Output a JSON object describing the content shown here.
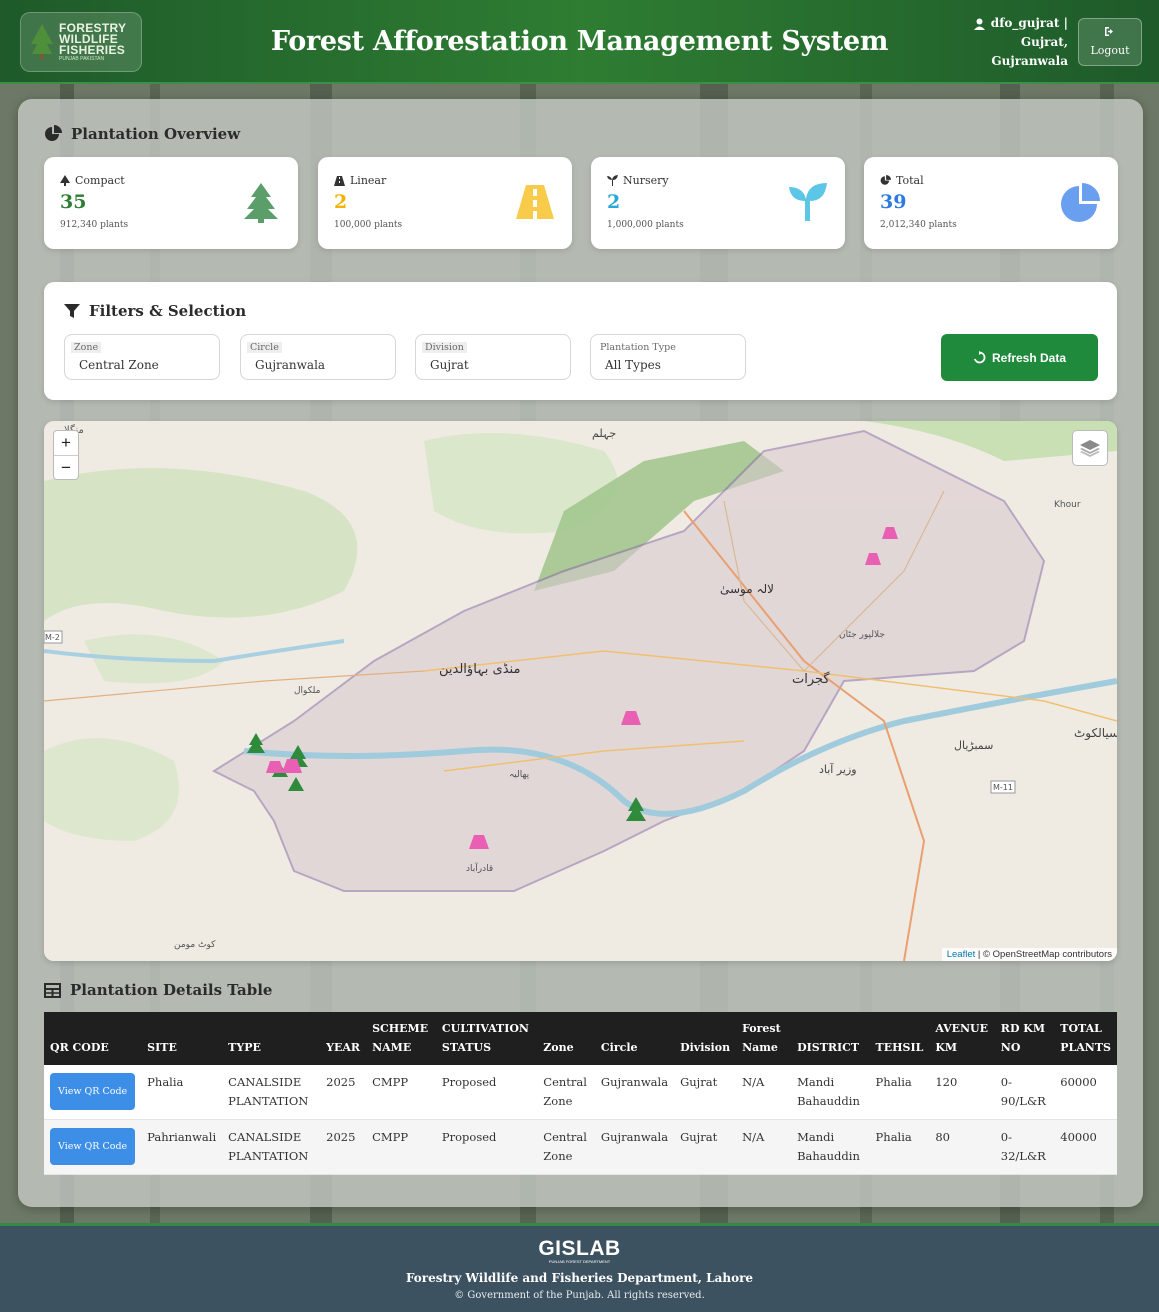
{
  "header": {
    "logo_text": [
      "FORESTRY",
      "WILDLIFE",
      "FISHERIES"
    ],
    "logo_sub": "PUNJAB PAKISTAN",
    "title": "Forest Afforestation Management System",
    "user_line1": "dfo_gujrat |",
    "user_line2": "Gujrat,",
    "user_line3": "Gujranwala",
    "logout_label": "Logout"
  },
  "overview": {
    "title": "Plantation Overview",
    "cards": [
      {
        "label": "Compact",
        "value": "35",
        "sub": "912,340 plants",
        "color": "#2e7d32",
        "icon": "tree-icon"
      },
      {
        "label": "Linear",
        "value": "2",
        "sub": "100,000 plants",
        "color": "#f0b400",
        "icon": "road-icon"
      },
      {
        "label": "Nursery",
        "value": "2",
        "sub": "1,000,000 plants",
        "color": "#29a8d8",
        "icon": "seedling-icon"
      },
      {
        "label": "Total",
        "value": "39",
        "sub": "2,012,340 plants",
        "color": "#2d7be0",
        "icon": "pie-chart-icon"
      }
    ]
  },
  "filters": {
    "title": "Filters & Selection",
    "fields": [
      {
        "label": "Zone",
        "value": "Central Zone"
      },
      {
        "label": "Circle",
        "value": "Gujranwala"
      },
      {
        "label": "Division",
        "value": "Gujrat"
      },
      {
        "label": "Plantation Type",
        "value": "All Types"
      }
    ],
    "refresh_label": "Refresh Data"
  },
  "map": {
    "zoom_in": "+",
    "zoom_out": "−",
    "attribution_leaflet": "Leaflet",
    "attribution_osm": " | © OpenStreetMap contributors",
    "labels": [
      "جہلم",
      "منڈی بہاؤالدین",
      "گجرات",
      "لالہ موسیٰ",
      "سیالکوٹ",
      "وزیر آباد",
      "پھالیہ",
      "قادرآباد",
      "Khour",
      "M-2",
      "M-11",
      "جلالپور جٹاں",
      "سمبڑیال",
      "کوٹ مومن",
      "ملکوال",
      "منگلا"
    ]
  },
  "table": {
    "title": "Plantation Details Table",
    "headers": [
      [
        "QR CODE"
      ],
      [
        "SITE"
      ],
      [
        "TYPE"
      ],
      [
        "YEAR"
      ],
      [
        "SCHEME",
        "NAME"
      ],
      [
        "CULTIVATION",
        "STATUS"
      ],
      [
        "Zone"
      ],
      [
        "Circle"
      ],
      [
        "Division"
      ],
      [
        "Forest",
        "Name"
      ],
      [
        "DISTRICT"
      ],
      [
        "TEHSIL"
      ],
      [
        "AVENUE",
        "KM"
      ],
      [
        "RD KM",
        "NO"
      ],
      [
        "TOTAL",
        "PLANTS"
      ]
    ],
    "rows": [
      {
        "qr": "View QR Code",
        "site": "Phalia",
        "type": "CANALSIDE PLANTATION",
        "year": "2025",
        "scheme": "CMPP",
        "status": "Proposed",
        "zone": "Central Zone",
        "circle": "Gujranwala",
        "division": "Gujrat",
        "forest": "N/A",
        "district": "Mandi Bahauddin",
        "tehsil": "Phalia",
        "avenue": "120",
        "rdkm": "0-90/L&R",
        "plants": "60000"
      },
      {
        "qr": "View QR Code",
        "site": "Pahrianwali",
        "type": "CANALSIDE PLANTATION",
        "year": "2025",
        "scheme": "CMPP",
        "status": "Proposed",
        "zone": "Central Zone",
        "circle": "Gujranwala",
        "division": "Gujrat",
        "forest": "N/A",
        "district": "Mandi Bahauddin",
        "tehsil": "Phalia",
        "avenue": "80",
        "rdkm": "0-32/L&R",
        "plants": "40000"
      }
    ]
  },
  "footer": {
    "brand": "GISLAB",
    "brand_sub": "PUNJAB FOREST DEPARTMENT",
    "org": "Forestry Wildlife and Fisheries Department, Lahore",
    "copyright": "© Government of the Punjab. All rights reserved."
  }
}
